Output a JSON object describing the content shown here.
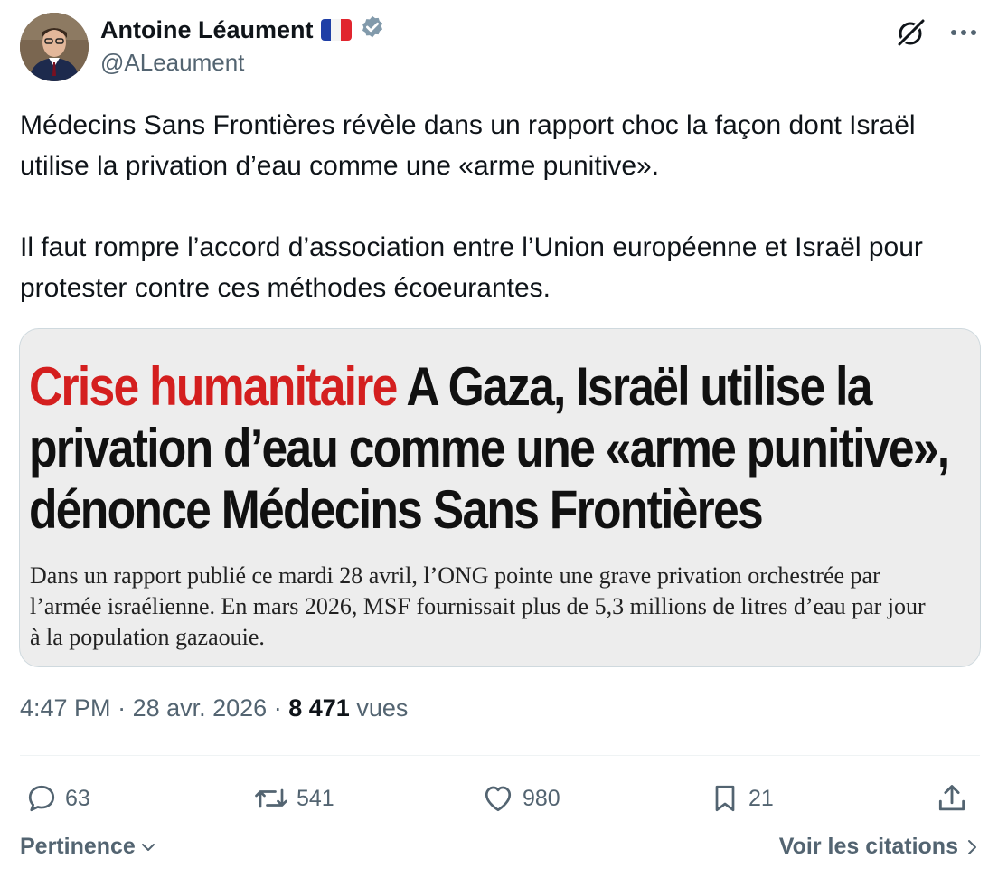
{
  "author": {
    "name": "Antoine Léaument",
    "handle": "@ALeaument",
    "flag_icon": "france-flag-icon",
    "verified_icon": "verified-badge-icon"
  },
  "tweet": {
    "paragraph_1": "Médecins Sans Frontières révèle dans un rapport choc la façon dont Israël utilise la privation d’eau comme une «arme punitive».",
    "paragraph_2": "Il faut rompre l’accord d’association entre l’Union européenne et Israël pour protester contre ces méthodes écoeurantes."
  },
  "media": {
    "headline_red": "Crise humanitaire",
    "headline_black": "A Gaza, Israël utilise la privation d’eau comme une «arme punitive», dénonce Médecins Sans Frontières",
    "summary": "Dans un rapport publié ce mardi 28 avril, l’ONG pointe une grave privation orchestrée par l’armée israélienne. En mars 2026, MSF fournissait plus de 5,3 millions de litres d’eau par jour à la population gazaouie."
  },
  "meta": {
    "time": "4:47 PM",
    "date": "28 avr. 2026",
    "views_count": "8 471",
    "views_label": "vues"
  },
  "actions": {
    "replies": "63",
    "retweets": "541",
    "likes": "980",
    "bookmarks": "21"
  },
  "footer": {
    "sort_label": "Pertinence",
    "quotes_label": "Voir les citations"
  },
  "colors": {
    "text_primary": "#0f1419",
    "text_secondary": "#536471",
    "verified": "#829aab",
    "headline_red": "#d41f1f"
  }
}
